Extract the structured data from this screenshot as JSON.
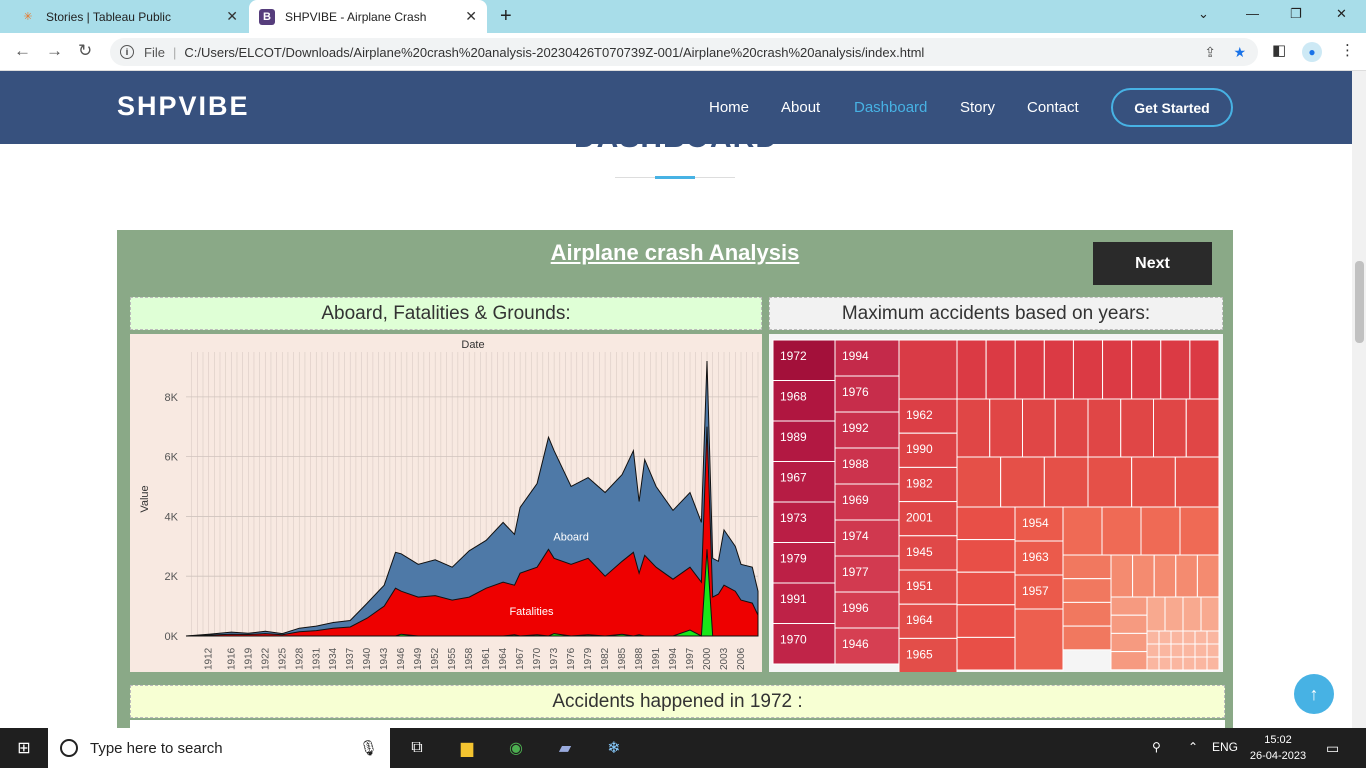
{
  "browser": {
    "tabs": [
      {
        "title": "Stories | Tableau Public",
        "favicon": "tableau-icon"
      },
      {
        "title": "SHPVIBE - Airplane Crash",
        "favicon": "bootstrap-icon",
        "active": true
      }
    ],
    "address": {
      "scheme_label": "File",
      "url": "C:/Users/ELCOT/Downloads/Airplane%20crash%20analysis-20230426T070739Z-001/Airplane%20crash%20analysis/index.html"
    }
  },
  "site": {
    "brand": "SHPVIBE",
    "nav": [
      "Home",
      "About",
      "Dashboard",
      "Story",
      "Contact"
    ],
    "active_nav": "Dashboard",
    "cta": "Get Started",
    "section_title": "DASHBOARD",
    "colors": {
      "header": "#37517e",
      "accent": "#47b2e4"
    }
  },
  "dashboard": {
    "title": "Airplane crash Analysis",
    "next_label": "Next",
    "panel1_title": "Aboard, Fatalities & Grounds:",
    "panel2_title": "Maximum accidents based on years:",
    "panel3_title": "Accidents happened in 1972 :"
  },
  "chart_data": [
    {
      "type": "area",
      "title": "Date",
      "ylabel": "Value",
      "ylim": [
        0,
        9500
      ],
      "yticks": [
        "0K",
        "2K",
        "4K",
        "6K",
        "8K"
      ],
      "xticks": [
        "1912",
        "1916",
        "1919",
        "1922",
        "1925",
        "1928",
        "1931",
        "1934",
        "1937",
        "1940",
        "1943",
        "1946",
        "1949",
        "1952",
        "1955",
        "1958",
        "1961",
        "1964",
        "1967",
        "1970",
        "1973",
        "1976",
        "1979",
        "1982",
        "1985",
        "1988",
        "1991",
        "1994",
        "1997",
        "2000",
        "2003",
        "2006"
      ],
      "x": [
        1908,
        1912,
        1916,
        1919,
        1922,
        1925,
        1928,
        1931,
        1934,
        1937,
        1940,
        1943,
        1945,
        1946,
        1949,
        1952,
        1955,
        1958,
        1961,
        1964,
        1966,
        1967,
        1970,
        1972,
        1973,
        1976,
        1979,
        1982,
        1985,
        1987,
        1988,
        1989,
        1991,
        1994,
        1997,
        1999,
        2000,
        2001,
        2002,
        2003,
        2005,
        2006,
        2008,
        2009
      ],
      "series": [
        {
          "name": "Aboard",
          "color": "#4e79a7",
          "values": [
            0,
            60,
            130,
            90,
            160,
            80,
            260,
            330,
            450,
            520,
            1100,
            1700,
            2800,
            2750,
            2400,
            2550,
            2300,
            2850,
            3200,
            3800,
            3400,
            4300,
            5100,
            6650,
            6200,
            5000,
            5300,
            4800,
            5400,
            6200,
            4500,
            5900,
            5000,
            4200,
            4800,
            3800,
            9200,
            2600,
            2500,
            3550,
            3000,
            2400,
            2300,
            1500
          ]
        },
        {
          "name": "Fatalities",
          "color": "#ee0000",
          "values": [
            0,
            30,
            60,
            50,
            80,
            40,
            140,
            180,
            260,
            300,
            600,
            1000,
            1600,
            1500,
            1300,
            1350,
            1200,
            1300,
            1600,
            1800,
            1700,
            2100,
            2300,
            2900,
            2600,
            2400,
            2600,
            2000,
            2500,
            2800,
            2100,
            2700,
            2300,
            1900,
            2300,
            1800,
            7000,
            1300,
            1400,
            1700,
            1500,
            1200,
            1100,
            700
          ]
        },
        {
          "name": "Ground",
          "color": "#19e619",
          "values": [
            0,
            0,
            0,
            0,
            0,
            0,
            0,
            0,
            0,
            0,
            0,
            0,
            0,
            60,
            0,
            0,
            0,
            0,
            0,
            0,
            40,
            0,
            40,
            0,
            80,
            0,
            40,
            0,
            60,
            0,
            40,
            0,
            0,
            0,
            200,
            0,
            2900,
            0,
            0,
            0,
            0,
            0,
            0,
            0
          ]
        }
      ],
      "annotations": [
        "Aboard",
        "Fatalities"
      ]
    },
    {
      "type": "treemap",
      "labels": [
        "1972",
        "1968",
        "1989",
        "1967",
        "1973",
        "1979",
        "1991",
        "1970",
        "1994",
        "1976",
        "1992",
        "1988",
        "1969",
        "1974",
        "1977",
        "1996",
        "1946",
        "1962",
        "1990",
        "1982",
        "2001",
        "1945",
        "1951",
        "1964",
        "1965",
        "1954",
        "1963",
        "1957"
      ]
    }
  ]
}
